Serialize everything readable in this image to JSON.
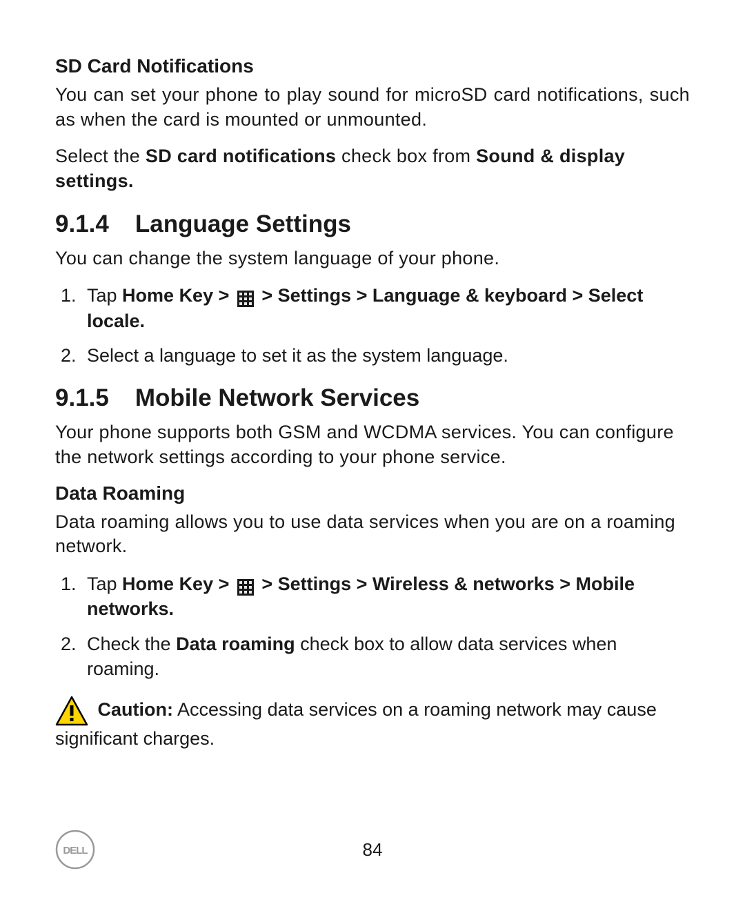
{
  "sd": {
    "heading": "SD Card Notifications",
    "p1": "You can set your phone to play sound for microSD card notifications, such as when the card is mounted or unmounted.",
    "p2_a": "Select the ",
    "p2_b": "SD card notifications",
    "p2_c": " check box from ",
    "p2_d": "Sound & display settings."
  },
  "lang": {
    "num": "9.1.4",
    "title": "Language Settings",
    "p1": "You can change the system language of your phone.",
    "li1_a": "Tap ",
    "li1_b": "Home Key > ",
    "li1_c": " > Settings > Language & keyboard > Select locale.",
    "li2": "Select a language to set it as the system language."
  },
  "mobile": {
    "num": "9.1.5",
    "title": "Mobile Network Services",
    "p1": "Your phone supports both GSM and WCDMA services. You can configure the network settings according to your phone service.",
    "sub": "Data Roaming",
    "p2": "Data roaming allows you to use data services when you are on a roaming network.",
    "li1_a": "Tap ",
    "li1_b": "Home Key > ",
    "li1_c": " > Settings > Wireless & networks > Mobile networks.",
    "li2_a": "Check the ",
    "li2_b": "Data roaming",
    "li2_c": " check box to allow data services when roaming."
  },
  "caution": {
    "label": "Caution:",
    "text": " Accessing data services on a roaming network may cause significant charges."
  },
  "footer": {
    "page": "84"
  }
}
